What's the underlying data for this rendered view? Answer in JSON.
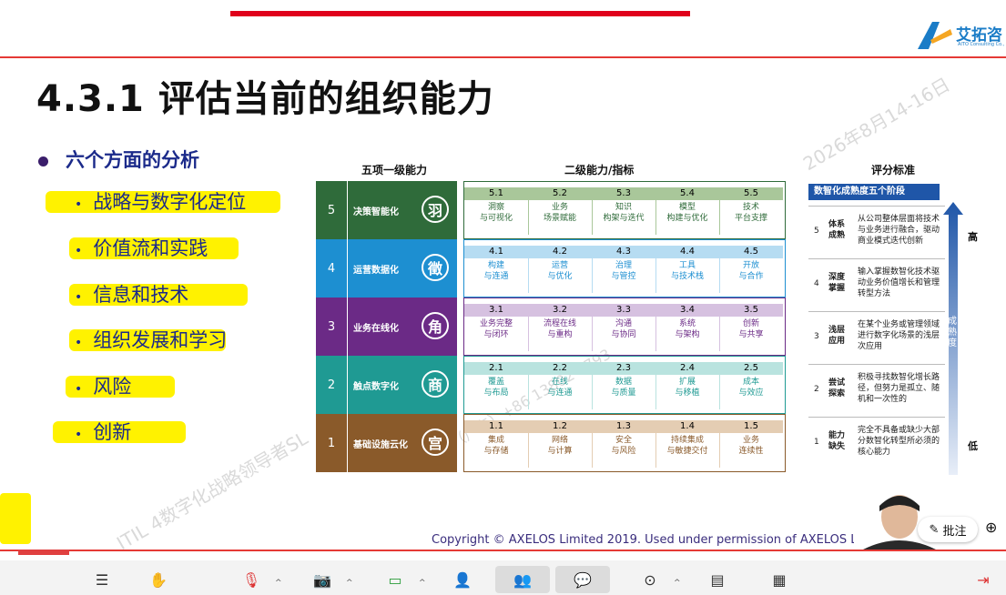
{
  "logo": {
    "name": "艾拓咨",
    "sub": "AITO Consulting Co.,"
  },
  "slide": {
    "title": "4.3.1 评估当前的组织能力",
    "watermark1": "2026年8月14-16日",
    "watermark2": "ITIL 4数字化战略领导者SL",
    "watermark3": "中国（广东）+86 13802 5793",
    "main_bullet": "六个方面的分析",
    "sub_bullets": [
      "战略与数字化定位",
      "价值流和实践",
      "信息和技术",
      "组织发展和学习",
      "风险",
      "创新"
    ]
  },
  "matrix": {
    "col1_header": "五项一级能力",
    "col2_header": "二级能力/指标",
    "levels": [
      {
        "num": "5",
        "name": "决策智能化",
        "badge": "羽",
        "color": "#2f6b3a",
        "light": "#a9c79a",
        "cells": [
          [
            "5.1",
            "洞察\n与可视化"
          ],
          [
            "5.2",
            "业务\n场景赋能"
          ],
          [
            "5.3",
            "知识\n构架与迭代"
          ],
          [
            "5.4",
            "模型\n构建与优化"
          ],
          [
            "5.5",
            "技术\n平台支撑"
          ]
        ]
      },
      {
        "num": "4",
        "name": "运营数据化",
        "badge": "徵",
        "color": "#1d8fd1",
        "light": "#b6dcf2",
        "cells": [
          [
            "4.1",
            "构建\n与连通"
          ],
          [
            "4.2",
            "运营\n与优化"
          ],
          [
            "4.3",
            "治理\n与管控"
          ],
          [
            "4.4",
            "工具\n与技术栈"
          ],
          [
            "4.5",
            "开放\n与合作"
          ]
        ]
      },
      {
        "num": "3",
        "name": "业务在线化",
        "badge": "角",
        "color": "#6b2a86",
        "light": "#d6c1e0",
        "cells": [
          [
            "3.1",
            "业务完整\n与闭环"
          ],
          [
            "3.2",
            "流程在线\n与重构"
          ],
          [
            "3.3",
            "沟通\n与协同"
          ],
          [
            "3.4",
            "系统\n与架构"
          ],
          [
            "3.5",
            "创新\n与共享"
          ]
        ]
      },
      {
        "num": "2",
        "name": "触点数字化",
        "badge": "商",
        "color": "#1f9a93",
        "light": "#b9e3df",
        "cells": [
          [
            "2.1",
            "覆盖\n与布局"
          ],
          [
            "2.2",
            "在线\n与连通"
          ],
          [
            "2.3",
            "数据\n与质量"
          ],
          [
            "2.4",
            "扩展\n与移植"
          ],
          [
            "2.5",
            "成本\n与效应"
          ]
        ]
      },
      {
        "num": "1",
        "name": "基础设施云化",
        "badge": "宫",
        "color": "#8a5a2a",
        "light": "#e4cdb3",
        "cells": [
          [
            "1.1",
            "集成\n与存储"
          ],
          [
            "1.2",
            "网络\n与计算"
          ],
          [
            "1.3",
            "安全\n与风险"
          ],
          [
            "1.4",
            "持续集成\n与敏捷交付"
          ],
          [
            "1.5",
            "业务\n连续性"
          ]
        ]
      }
    ]
  },
  "scoring": {
    "title": "评分标准",
    "header": "数智化成熟度五个阶段",
    "high": "高",
    "low": "低",
    "arrow_label": "成熟度",
    "rows": [
      {
        "n": "5",
        "label": "体系成熟",
        "desc": "从公司整体层面将技术与业务进行融合，驱动商业模式迭代创新"
      },
      {
        "n": "4",
        "label": "深度掌握",
        "desc": "输入掌握数智化技术驱动业务价值增长和管理转型方法"
      },
      {
        "n": "3",
        "label": "浅层应用",
        "desc": "在某个业务或管理领域进行数字化场景的浅层次应用"
      },
      {
        "n": "2",
        "label": "尝试探索",
        "desc": "积极寻找数智化增长路径，但努力是孤立、随机和一次性的"
      },
      {
        "n": "1",
        "label": "能力缺失",
        "desc": "完全不具备或缺少大部分数智化转型所必须的核心能力"
      }
    ]
  },
  "copyright": "Copyright © AXELOS Limited 2019. Used under permission of AXELOS Limi",
  "overlay": {
    "annotate": "批注"
  },
  "toolbar_icons": [
    "sidebar-toggle-icon",
    "hand-icon",
    "microphone-muted-icon",
    "camera-off-icon",
    "share-screen-icon",
    "add-user-icon",
    "participants-icon",
    "chat-icon",
    "record-icon",
    "document-icon",
    "apps-icon",
    "leave-icon"
  ]
}
